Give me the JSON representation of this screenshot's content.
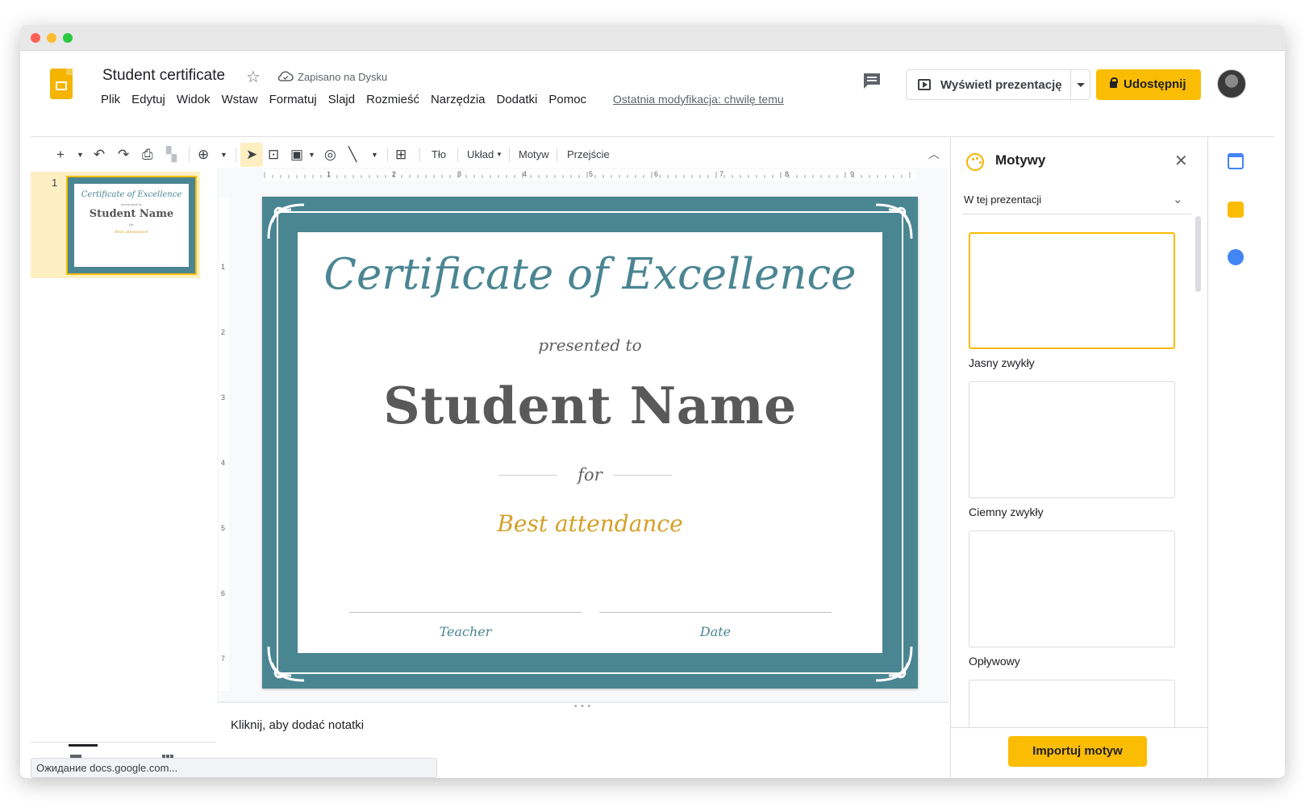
{
  "header": {
    "doc_title": "Student certificate",
    "saved_status": "Zapisano na Dysku",
    "last_modified": "Ostatnia modyfikacja: chwilę temu",
    "present_label": "Wyświetl prezentację",
    "share_label": "Udostępnij"
  },
  "menu": [
    "Plik",
    "Edytuj",
    "Widok",
    "Wstaw",
    "Formatuj",
    "Slajd",
    "Rozmieść",
    "Narzędzia",
    "Dodatki",
    "Pomoc"
  ],
  "toolbar": {
    "background": "Tło",
    "layout": "Układ",
    "theme": "Motyw",
    "transition": "Przejście"
  },
  "filmstrip": {
    "slide_number": "1",
    "status_tip": "Ожидание docs.google.com..."
  },
  "rulers": {
    "horizontal": [
      "1",
      "2",
      "3",
      "4",
      "5",
      "6",
      "7",
      "8",
      "9"
    ],
    "vertical": [
      "1",
      "2",
      "3",
      "4",
      "5",
      "6",
      "7"
    ]
  },
  "slide": {
    "title": "Certificate of Excellence",
    "presented": "presented to",
    "student_name": "Student Name",
    "for_text": "for",
    "reason": "Best attendance",
    "sig_left": "Teacher",
    "sig_right": "Date"
  },
  "notes": {
    "placeholder": "Kliknij, aby dodać notatki"
  },
  "themes_panel": {
    "title": "Motywy",
    "filter": "W tej prezentacji",
    "themes": [
      "Jasny zwykły",
      "Ciemny zwykły",
      "Opływowy"
    ],
    "import_label": "Importuj motyw"
  },
  "colors": {
    "accent": "#fbbc04",
    "slide_teal": "#4a8592",
    "reason_gold": "#d4a027"
  }
}
